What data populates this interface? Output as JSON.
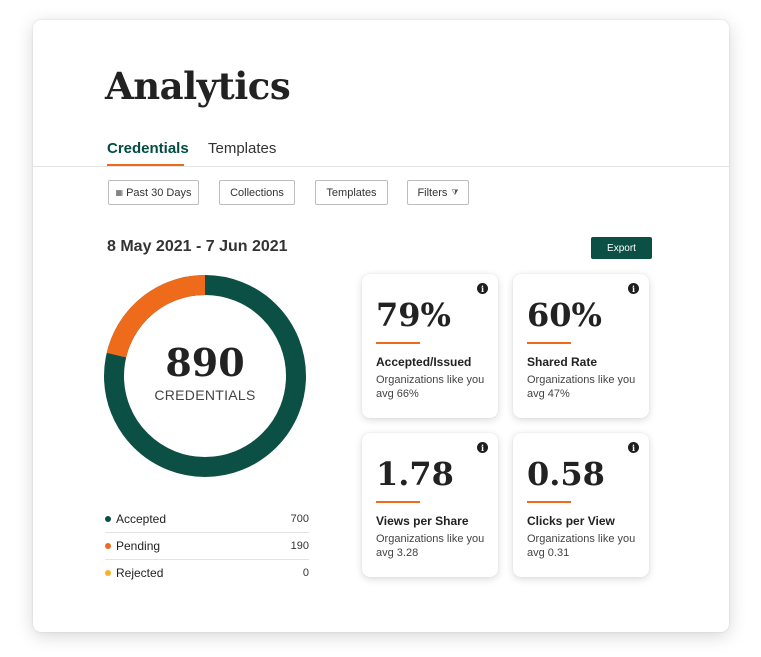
{
  "page": {
    "title": "Analytics"
  },
  "tabs": [
    {
      "label": "Credentials",
      "active": true
    },
    {
      "label": "Templates",
      "active": false
    }
  ],
  "filters": {
    "date": {
      "label": "Past 30 Days",
      "icon": "calendar-icon"
    },
    "collections": {
      "label": "Collections"
    },
    "templates": {
      "label": "Templates"
    },
    "filters": {
      "label": "Filters",
      "icon": "filter-icon"
    }
  },
  "date_range": "8 May 2021 - 7 Jun 2021",
  "export_label": "Export",
  "donut": {
    "total": "890",
    "label": "CREDENTIALS",
    "colors": {
      "accepted": "#0b4f45",
      "pending": "#ee6b1c",
      "rejected": "#f5b32a"
    }
  },
  "legend": [
    {
      "label": "Accepted",
      "count": "700",
      "color": "#0b4f45"
    },
    {
      "label": "Pending",
      "count": "190",
      "color": "#ee6b1c"
    },
    {
      "label": "Rejected",
      "count": "0",
      "color": "#f5b32a"
    }
  ],
  "metrics": [
    {
      "value": "79%",
      "label": "Accepted/Issued",
      "sub": "Organizations like you avg 66%"
    },
    {
      "value": "60%",
      "label": "Shared Rate",
      "sub": "Organizations like you avg 47%"
    },
    {
      "value": "1.78",
      "label": "Views per Share",
      "sub": "Organizations like you avg 3.28"
    },
    {
      "value": "0.58",
      "label": "Clicks per View",
      "sub": "Organizations like you avg 0.31"
    }
  ],
  "colors": {
    "brand": "#0b4f45",
    "accent": "#ee6b1c"
  }
}
